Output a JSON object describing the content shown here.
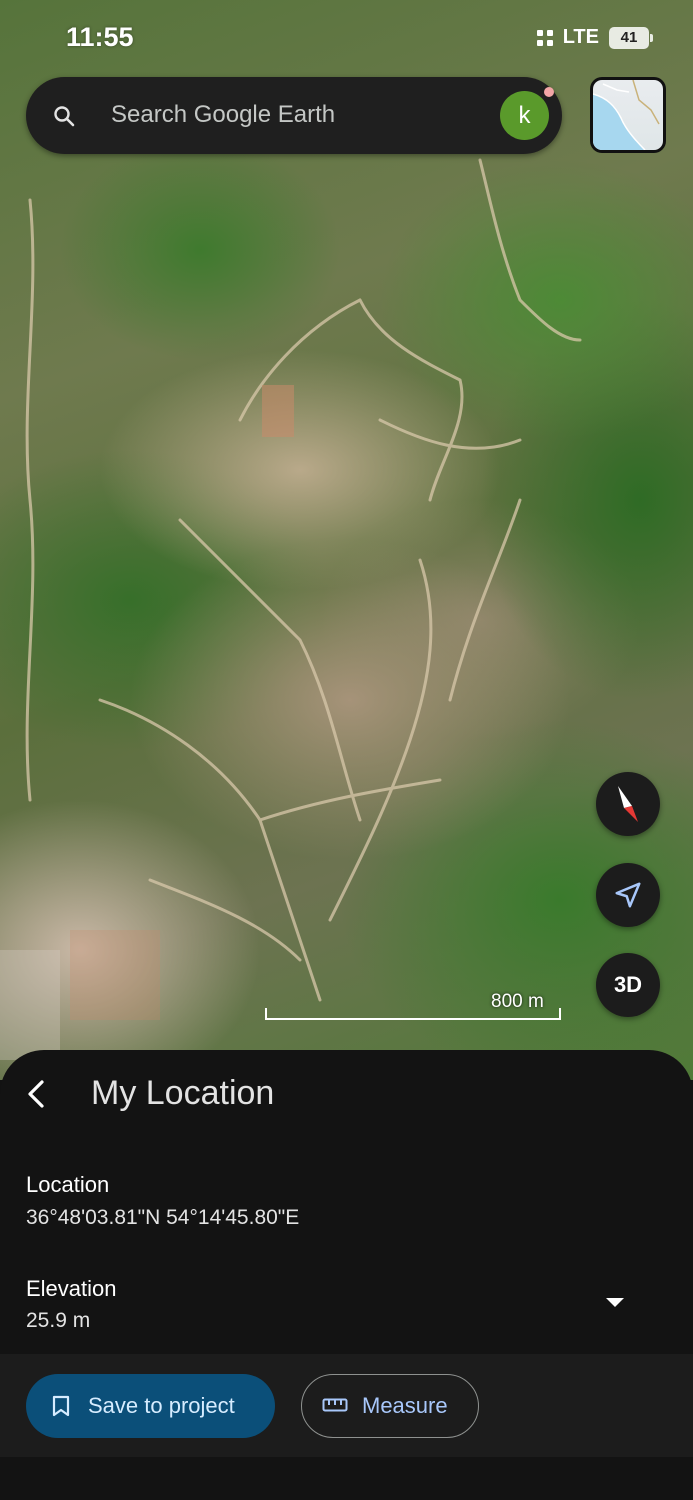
{
  "status_bar": {
    "time": "11:55",
    "network": "LTE",
    "battery": "41"
  },
  "search": {
    "placeholder": "Search Google Earth",
    "avatar_letter": "k"
  },
  "map": {
    "scale_label": "800 m",
    "three_d_label": "3D"
  },
  "sheet": {
    "title": "My Location",
    "location_label": "Location",
    "location_value": "36°48'03.81\"N 54°14'45.80\"E",
    "elevation_label": "Elevation",
    "elevation_value": "25.9 m"
  },
  "actions": {
    "save_label": "Save to project",
    "measure_label": "Measure"
  },
  "colors": {
    "save_button_bg": "#0b4f79",
    "accent_text": "#a8c7fa",
    "avatar_bg": "#5a9a2b"
  },
  "icons": [
    "search-icon",
    "avatar",
    "layers-minimap",
    "compass-icon",
    "locate-icon",
    "back-icon",
    "dropdown-icon",
    "bookmark-icon",
    "ruler-icon"
  ]
}
